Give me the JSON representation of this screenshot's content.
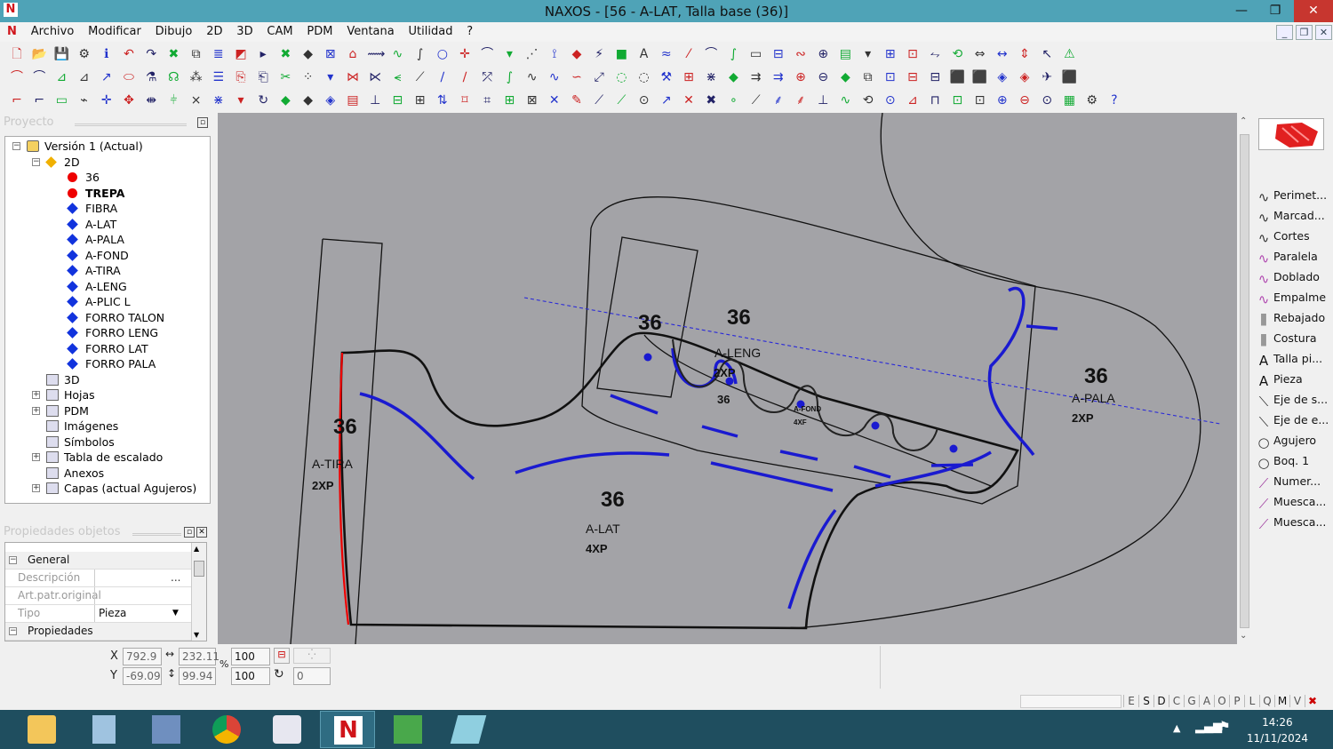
{
  "window": {
    "title": "NAXOS - [56 - A-LAT, Talla base (36)]",
    "app_icon": "N",
    "minimize": "—",
    "restore": "❐",
    "close": "✕"
  },
  "menu": [
    "Archivo",
    "Modificar",
    "Dibujo",
    "2D",
    "3D",
    "CAM",
    "PDM",
    "Ventana",
    "Utilidad",
    "?"
  ],
  "project_panel": {
    "title": "Proyecto"
  },
  "tree": {
    "root": "Versión 1 (Actual)",
    "node_2d": "2D",
    "pieces": [
      {
        "label": "36",
        "type": "red-dot",
        "bold": false
      },
      {
        "label": "TREPA",
        "type": "red-dot",
        "bold": true
      },
      {
        "label": "FIBRA",
        "type": "blue-diamond"
      },
      {
        "label": "A-LAT",
        "type": "blue-diamond"
      },
      {
        "label": "A-PALA",
        "type": "blue-diamond"
      },
      {
        "label": "A-FOND",
        "type": "blue-diamond"
      },
      {
        "label": "A-TIRA",
        "type": "blue-diamond"
      },
      {
        "label": "A-LENG",
        "type": "blue-diamond"
      },
      {
        "label": "A-PLIC L",
        "type": "blue-diamond"
      },
      {
        "label": "FORRO TALON",
        "type": "blue-diamond"
      },
      {
        "label": "FORRO LENG",
        "type": "blue-diamond"
      },
      {
        "label": "FORRO LAT",
        "type": "blue-diamond"
      },
      {
        "label": "FORRO PALA",
        "type": "blue-diamond"
      }
    ],
    "others": [
      "3D",
      "Hojas",
      "PDM",
      "Imágenes",
      "Símbolos",
      "Tabla de escalado",
      "Anexos",
      "Capas (actual Agujeros)"
    ]
  },
  "properties_panel": {
    "title": "Propiedades objetos",
    "section_general": "General",
    "rows": [
      {
        "key": "Descripción",
        "value": "",
        "btn": "..."
      },
      {
        "key": "Art.patr.original",
        "value": ""
      },
      {
        "key": "Tipo",
        "value": "Pieza"
      }
    ],
    "section_props": "Propiedades"
  },
  "canvas": {
    "labels": [
      {
        "t": "36",
        "k": "big"
      },
      {
        "t": "36",
        "k": "big"
      },
      {
        "t": "36",
        "k": "big"
      },
      {
        "t": "36",
        "k": "big"
      },
      {
        "t": "36",
        "k": "big"
      },
      {
        "t": "A-TIRA",
        "k": "name"
      },
      {
        "t": "2XP",
        "k": "small"
      },
      {
        "t": "A-LAT",
        "k": "name"
      },
      {
        "t": "4XP",
        "k": "small"
      },
      {
        "t": "A-LENG",
        "k": "name"
      },
      {
        "t": "2XP",
        "k": "small"
      },
      {
        "t": "36",
        "k": "small"
      },
      {
        "t": "A-PALA",
        "k": "name"
      },
      {
        "t": "2XP",
        "k": "small"
      },
      {
        "t": "A-FOND",
        "k": "tiny"
      },
      {
        "t": "4XF",
        "k": "tiny"
      }
    ]
  },
  "right_panel": {
    "items": [
      {
        "label": "Perimet...",
        "icon": "wave-icon"
      },
      {
        "label": "Marcad...",
        "icon": "wave-icon"
      },
      {
        "label": "Cortes",
        "icon": "wave-icon"
      },
      {
        "label": "Paralela",
        "icon": "wave-icon"
      },
      {
        "label": "Doblado",
        "icon": "wave-icon"
      },
      {
        "label": "Empalme",
        "icon": "wave-icon"
      },
      {
        "label": "Rebajado",
        "icon": "stitch-icon"
      },
      {
        "label": "Costura",
        "icon": "stitch-icon"
      },
      {
        "label": "Talla pi...",
        "icon": "text-icon"
      },
      {
        "label": "Pieza",
        "icon": "text-icon"
      },
      {
        "label": "Eje de s...",
        "icon": "axis-icon"
      },
      {
        "label": "Eje de e...",
        "icon": "axis-icon"
      },
      {
        "label": "Agujero",
        "icon": "circle-icon"
      },
      {
        "label": "Boq. 1",
        "icon": "circle-icon"
      },
      {
        "label": "Numer...",
        "icon": "notch-icon"
      },
      {
        "label": "Muesca...",
        "icon": "notch-icon"
      },
      {
        "label": "Muesca...",
        "icon": "notch-icon"
      }
    ]
  },
  "status": {
    "x_label": "X",
    "y_label": "Y",
    "x": "792.9",
    "y": "-69.09",
    "w": "232.11",
    "h": "99.94",
    "scale_x": "100",
    "scale_y": "100",
    "pct": "%",
    "angle": "0",
    "letters": [
      "E",
      "S",
      "D",
      "C",
      "G",
      "A",
      "O",
      "P",
      "L",
      "Q",
      "M",
      "V"
    ]
  },
  "taskbar": {
    "time": "14:26",
    "date": "11/11/2024"
  }
}
